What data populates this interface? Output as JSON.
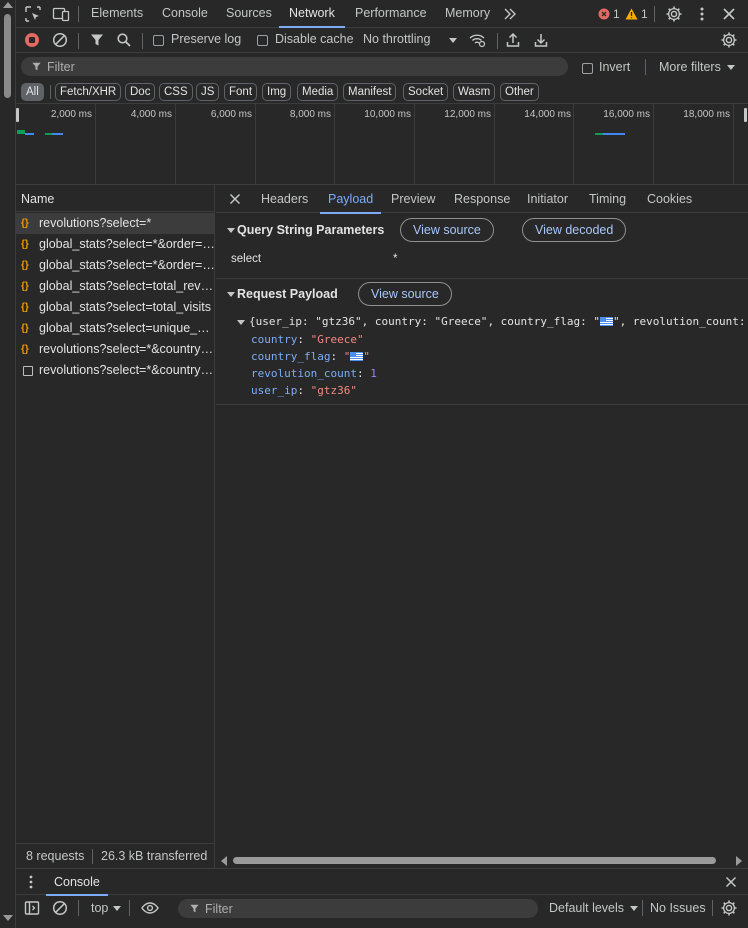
{
  "tabbar": {
    "tabs": [
      "Elements",
      "Console",
      "Sources",
      "Network",
      "Performance",
      "Memory"
    ],
    "active_tab": "Network",
    "error_count": "1",
    "warning_count": "1"
  },
  "network_toolbar": {
    "preserve_log": "Preserve log",
    "disable_cache": "Disable cache",
    "throttling": "No throttling"
  },
  "filter": {
    "placeholder": "Filter",
    "invert": "Invert",
    "more_filters": "More filters"
  },
  "types": [
    "All",
    "Fetch/XHR",
    "Doc",
    "CSS",
    "JS",
    "Font",
    "Img",
    "Media",
    "Manifest",
    "Socket",
    "Wasm",
    "Other"
  ],
  "overview": {
    "ticks": [
      "2,000 ms",
      "4,000 ms",
      "6,000 ms",
      "8,000 ms",
      "10,000 ms",
      "12,000 ms",
      "14,000 ms",
      "16,000 ms",
      "18,000 ms"
    ],
    "colors": {
      "waiting": "#0f9d58",
      "download": "#4285f4"
    }
  },
  "requests": {
    "header": "Name",
    "rows": [
      {
        "name": "revolutions?select=*",
        "kind": "fetch"
      },
      {
        "name": "global_stats?select=*&order=t...",
        "kind": "fetch"
      },
      {
        "name": "global_stats?select=*&order=t...",
        "kind": "fetch"
      },
      {
        "name": "global_stats?select=total_revo...",
        "kind": "fetch"
      },
      {
        "name": "global_stats?select=total_visits",
        "kind": "fetch"
      },
      {
        "name": "global_stats?select=unique_us...",
        "kind": "fetch"
      },
      {
        "name": "revolutions?select=*&country=...",
        "kind": "fetch"
      },
      {
        "name": "revolutions?select=*&country=...",
        "kind": "document"
      }
    ],
    "summary_requests": "8 requests",
    "summary_transferred": "26.3 kB transferred"
  },
  "details": {
    "tabs": [
      "Headers",
      "Payload",
      "Preview",
      "Response",
      "Initiator",
      "Timing",
      "Cookies"
    ],
    "active_tab": "Payload",
    "query": {
      "title": "Query String Parameters",
      "view_source": "View source",
      "view_decoded": "View decoded",
      "param_key": "select",
      "param_value": "*"
    },
    "payload": {
      "title": "Request Payload",
      "view_source": "View source",
      "summary_open": "{user_ip: ",
      "summary_ip": "\"gtz36\"",
      "summary_mid1": ", country: ",
      "summary_country": "\"Greece\"",
      "summary_mid2": ", country_flag: ",
      "summary_flag_open": "\"",
      "summary_flag_close": "\"",
      "summary_mid3": ", revolution_count:",
      "fields": {
        "country_key": "country",
        "country_val": "\"Greece\"",
        "flag_key": "country_flag",
        "flag_open": "\"",
        "flag_close": "\"",
        "count_key": "revolution_count",
        "count_val": "1",
        "ip_key": "user_ip",
        "ip_val": "\"gtz36\""
      }
    }
  },
  "drawer": {
    "tab": "Console",
    "context": "top",
    "filter_placeholder": "Filter",
    "levels": "Default levels",
    "issues": "No Issues"
  }
}
